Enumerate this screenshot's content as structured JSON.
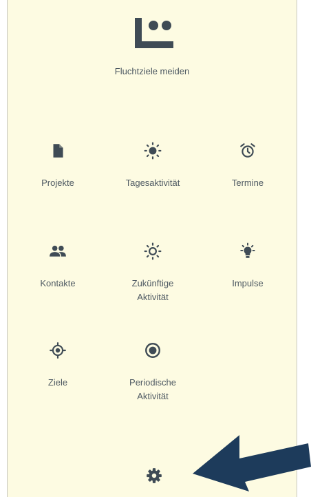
{
  "app": {
    "title": "Fluchtziele meiden"
  },
  "tiles": [
    {
      "label": "Projekte",
      "icon": "document-icon"
    },
    {
      "label": "Tagesaktivität",
      "icon": "sun-icon"
    },
    {
      "label": "Termine",
      "icon": "alarm-clock-icon"
    },
    {
      "label": "Kontakte",
      "icon": "people-icon"
    },
    {
      "label": "Zukünftige\nAktivität",
      "icon": "sun-outline-icon"
    },
    {
      "label": "Impulse",
      "icon": "lightbulb-icon"
    },
    {
      "label": "Ziele",
      "icon": "target-icon"
    },
    {
      "label": "Periodische\nAktivität",
      "icon": "radio-button-icon"
    }
  ],
  "footer": {
    "icon": "gear-icon"
  },
  "colors": {
    "background": "#fdfbe2",
    "icon": "#3f4b55",
    "arrow": "#1d3b5b"
  }
}
